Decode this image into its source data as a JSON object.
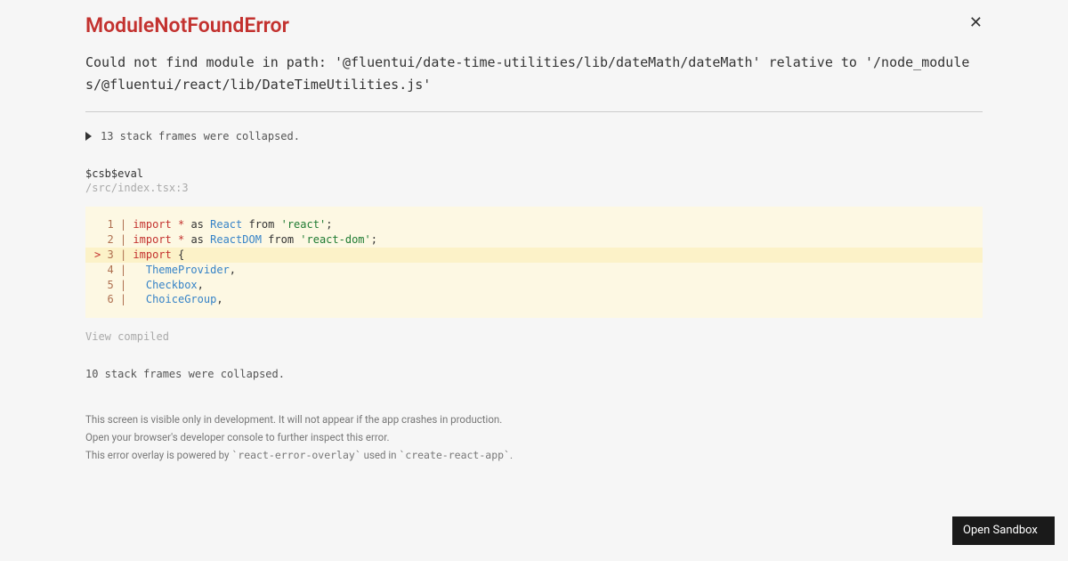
{
  "error": {
    "title": "ModuleNotFoundError",
    "message": "Could not find module in path: '@fluentui/date-time-utilities/lib/dateMath/dateMath' relative to '/node_modules/@fluentui/react/lib/DateTimeUtilities.js'"
  },
  "collapse1": "13 stack frames were collapsed.",
  "frame": {
    "name": "$csb$eval",
    "path": "/src/index.tsx:3"
  },
  "code": {
    "lines": [
      {
        "num": "1",
        "tokens": [
          [
            "kw",
            "import"
          ],
          [
            "plain",
            " "
          ],
          [
            "op",
            "*"
          ],
          [
            "plain",
            " as "
          ],
          [
            "ident",
            "React"
          ],
          [
            "plain",
            " from "
          ],
          [
            "str",
            "'react'"
          ],
          [
            "punct",
            ";"
          ]
        ]
      },
      {
        "num": "2",
        "tokens": [
          [
            "kw",
            "import"
          ],
          [
            "plain",
            " "
          ],
          [
            "op",
            "*"
          ],
          [
            "plain",
            " as "
          ],
          [
            "ident",
            "ReactDOM"
          ],
          [
            "plain",
            " from "
          ],
          [
            "str",
            "'react-dom'"
          ],
          [
            "punct",
            ";"
          ]
        ]
      },
      {
        "num": "3",
        "hl": true,
        "tokens": [
          [
            "kw",
            "import"
          ],
          [
            "plain",
            " "
          ],
          [
            "punct",
            "{"
          ]
        ]
      },
      {
        "num": "4",
        "tokens": [
          [
            "plain",
            "  "
          ],
          [
            "ident",
            "ThemeProvider"
          ],
          [
            "punct",
            ","
          ]
        ]
      },
      {
        "num": "5",
        "tokens": [
          [
            "plain",
            "  "
          ],
          [
            "ident",
            "Checkbox"
          ],
          [
            "punct",
            ","
          ]
        ]
      },
      {
        "num": "6",
        "tokens": [
          [
            "plain",
            "  "
          ],
          [
            "ident",
            "ChoiceGroup"
          ],
          [
            "punct",
            ","
          ]
        ]
      }
    ]
  },
  "viewCompiled": "View compiled",
  "collapse2": "10 stack frames were collapsed.",
  "footer": {
    "line1": "This screen is visible only in development. It will not appear if the app crashes in production.",
    "line2": "Open your browser's developer console to further inspect this error.",
    "line3_pre": "This error overlay is powered by ",
    "line3_code1": "`react-error-overlay`",
    "line3_mid": " used in ",
    "line3_code2": "`create-react-app`",
    "line3_post": "."
  },
  "openSandbox": "Open Sandbox"
}
